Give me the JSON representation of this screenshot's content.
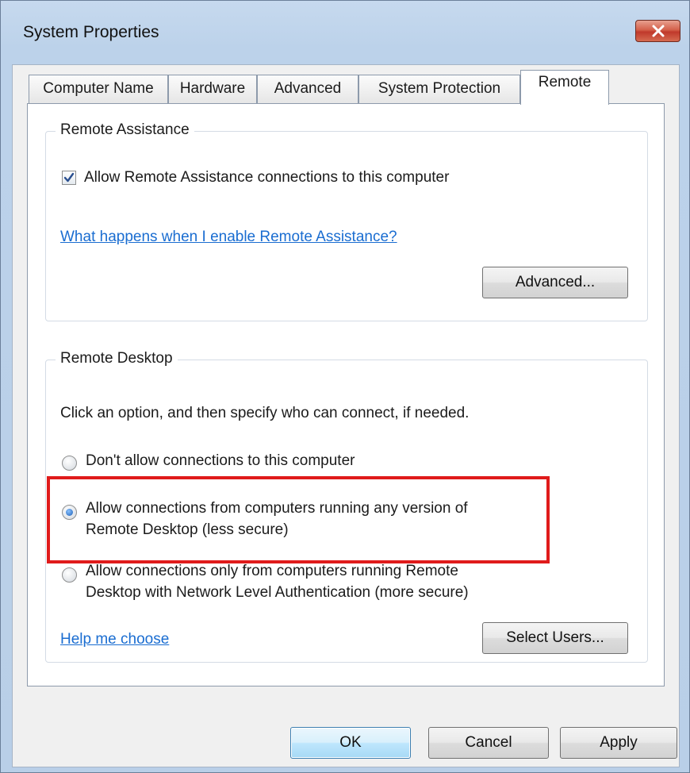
{
  "window": {
    "title": "System Properties"
  },
  "tabs": [
    {
      "label": "Computer Name"
    },
    {
      "label": "Hardware"
    },
    {
      "label": "Advanced"
    },
    {
      "label": "System Protection"
    },
    {
      "label": "Remote"
    }
  ],
  "remote_assistance": {
    "group_title": "Remote Assistance",
    "allow_checkbox_label": "Allow Remote Assistance connections to this computer",
    "allow_checked": true,
    "help_link": "What happens when I enable Remote Assistance?",
    "advanced_button": "Advanced..."
  },
  "remote_desktop": {
    "group_title": "Remote Desktop",
    "instruction": "Click an option, and then specify who can connect, if needed.",
    "option_dont_allow": "Don't allow connections to this computer",
    "option_any_line1": "Allow connections from computers running any version of",
    "option_any_line2": "Remote Desktop (less secure)",
    "option_nla_line1": "Allow connections only from computers running Remote",
    "option_nla_line2": "Desktop with Network Level Authentication (more secure)",
    "selected_option": "any",
    "help_link": "Help me choose",
    "select_users_button": "Select Users..."
  },
  "footer": {
    "ok_button": "OK",
    "cancel_button": "Cancel",
    "apply_button": "Apply"
  },
  "colors": {
    "highlight": "#e01b1b",
    "link": "#1a6dd1"
  }
}
